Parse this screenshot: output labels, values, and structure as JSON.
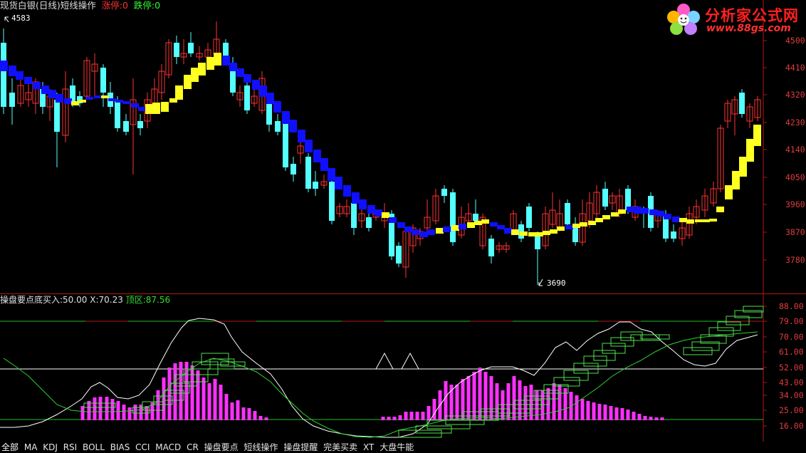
{
  "header": {
    "title": "现货白银(日线)短线操作",
    "limit_up_label": "涨停:0",
    "limit_down_label": "跌停:0"
  },
  "logo": {
    "title": "分析家公式网",
    "url": "www.88gs.com"
  },
  "price_panel": {
    "high_marker": "4583",
    "low_marker": "3690",
    "y_axis_ticks": [
      "4500",
      "4410",
      "4320",
      "4230",
      "4140",
      "4050",
      "3960",
      "3870",
      "3780"
    ]
  },
  "indicator_panel": {
    "name": "操盘要点底买入:",
    "bottom_buy_value": "50.00",
    "x_label": "X:",
    "x_value": "70.23",
    "top_zone_label": "顶区:",
    "top_zone_value": "87.56",
    "y_axis_ticks": [
      "88.00",
      "79.00",
      "70.00",
      "61.00",
      "52.00",
      "43.00",
      "34.00",
      "25.00",
      "16.00"
    ]
  },
  "colors": {
    "up_candle": "#ff3232",
    "down_candle": "#54ffff",
    "band_blue": "#1010ff",
    "band_yellow": "#ffff20",
    "magenta": "#ff30ff",
    "grid_red": "#a01818"
  },
  "tabs": [
    "全部",
    "MA",
    "KDJ",
    "RSI",
    "BOLL",
    "BIAS",
    "CCI",
    "MACD",
    "CR",
    "操盘要点",
    "短线操作",
    "操盘提醒",
    "完美买卖",
    "XT",
    "大盘牛能"
  ]
}
